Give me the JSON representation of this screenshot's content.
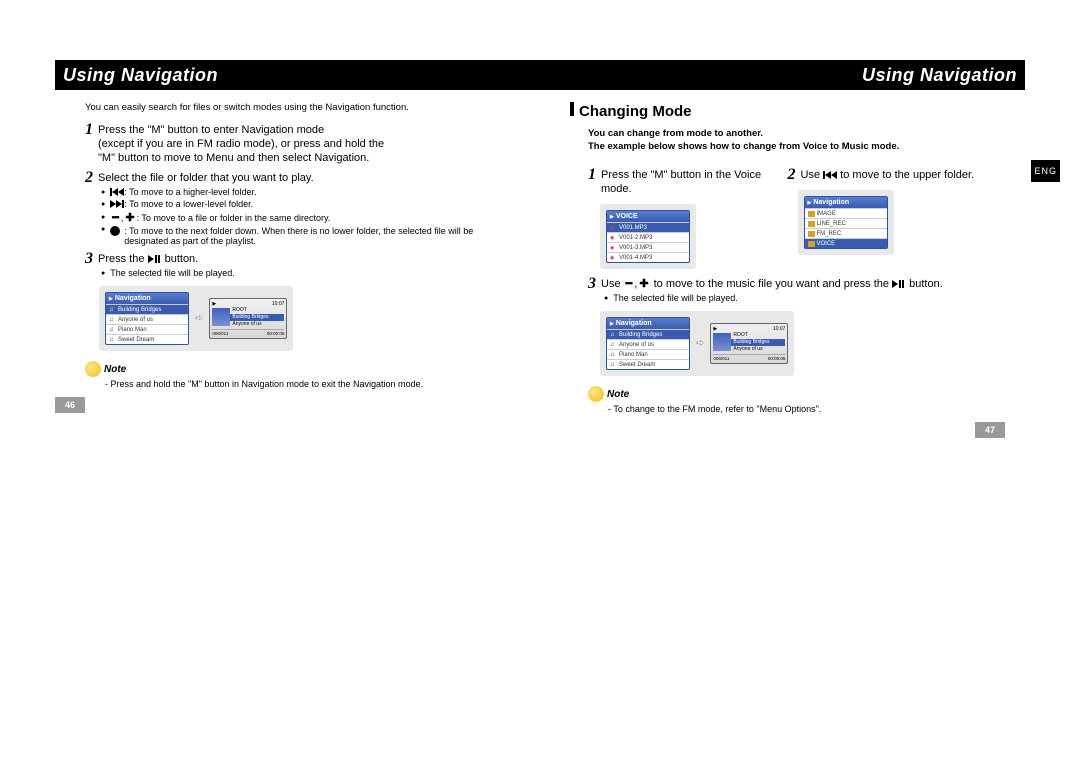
{
  "header": {
    "title_left": "Using Navigation",
    "title_right": "Using Navigation"
  },
  "left": {
    "intro": "You can easily search for files or switch modes using the Navigation function.",
    "step1": "Press the \"M\" button to enter Navigation mode\n(except if you are in FM radio mode), or press and hold the\n\"M\" button to move to Menu and then select Navigation.",
    "step2": "Select the file or folder that you want to play.",
    "bullets": {
      "b1": ": To move to a higher-level folder.",
      "b2": ": To move to a lower-level folder.",
      "b3": ": To move to a file or folder in the same directory.",
      "b4": ": To move to the next folder down. When there is no lower folder, the selected file will be designated as part of the playlist."
    },
    "step3_a": "Press the ",
    "step3_b": " button.",
    "sub3": "The selected file will be played.",
    "note_label": "Note",
    "note_text": "- Press and hold the \"M\" button in Navigation mode to exit the Navigation mode.",
    "page_num": "46",
    "nav_screen": {
      "title": "Navigation",
      "rows": [
        "Building Bridges",
        "Anyone of us",
        "Piano Man",
        "Sweet Dream"
      ]
    },
    "play_screen": {
      "root": "ROOT",
      "song": "Building Bridges",
      "artist": "Anyone of us",
      "counter": "006/011",
      "time": "00:00:05",
      "clock": "10:07"
    }
  },
  "right": {
    "section": "Changing Mode",
    "intro1": "You can change from mode to another.",
    "intro2": "The example below shows how to change from Voice to Music mode.",
    "step1": "Press the \"M\" button in the Voice mode.",
    "step2_a": "Use ",
    "step2_b": " to move to the upper folder.",
    "voice_screen": {
      "title": "VOICE",
      "rows": [
        "V001.MP3",
        "V001-2.MP3",
        "V001-3.MP3",
        "V001-4.MP3"
      ]
    },
    "nav_screen": {
      "title": "Navigation",
      "rows": [
        "IMAGE",
        "LINE_REC",
        "FM_REC",
        "VOICE"
      ]
    },
    "step3_a": "Use ",
    "step3_b": " to move to the music file you want and press the ",
    "step3_c": " button.",
    "sub3": "The selected file will be played.",
    "note_label": "Note",
    "note_text": "- To change to the FM mode, refer to \"Menu Options\".",
    "page_num": "47",
    "lang": "ENG",
    "nav_screen2": {
      "title": "Navigation",
      "rows": [
        "Building Bridges",
        "Anyone of us",
        "Piano Man",
        "Sweet Dream"
      ]
    },
    "play_screen": {
      "root": "ROOT",
      "song": "Building Bridges",
      "artist": "Anyone of us",
      "counter": "006/011",
      "time": "00:00:05",
      "clock": "10:07"
    }
  }
}
